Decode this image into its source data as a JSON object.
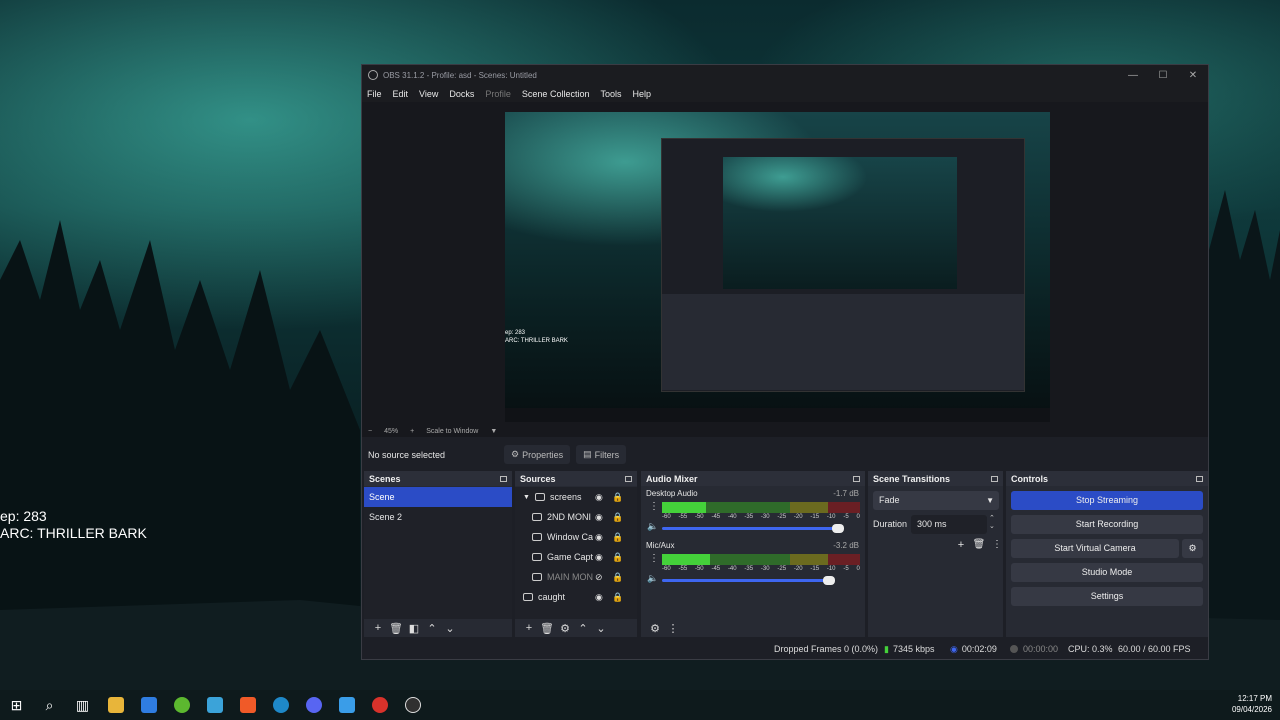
{
  "desktop": {
    "overlay_line1": "ep: 283",
    "overlay_line2": "ARC: THRILLER BARK"
  },
  "window": {
    "title": "OBS 31.1.2 - Profile: asd - Scenes: Untitled",
    "controls": [
      "—",
      "☐",
      "✕"
    ]
  },
  "menu": [
    "File",
    "Edit",
    "View",
    "Docks",
    "Profile",
    "Scene Collection",
    "Tools",
    "Help"
  ],
  "preview": {
    "zoom_minus": "−",
    "zoom_level": "45%",
    "zoom_plus": "+",
    "scale_mode": "Scale to Window",
    "overlay_line1": "ep: 283",
    "overlay_line2": "ARC: THRILLER BARK"
  },
  "properties_bar": {
    "no_source": "No source selected",
    "properties_label": "Properties",
    "filters_label": "Filters"
  },
  "scenes": {
    "title": "Scenes",
    "items": [
      {
        "label": "Scene",
        "selected": true
      },
      {
        "label": "Scene 2",
        "selected": false
      }
    ]
  },
  "sources": {
    "title": "Sources",
    "items": [
      {
        "label": "screens",
        "type": "group",
        "indent": 0
      },
      {
        "label": "2ND MONI",
        "type": "display",
        "indent": 1
      },
      {
        "label": "Window Ca",
        "type": "window",
        "indent": 1
      },
      {
        "label": "Game Capt",
        "type": "game",
        "indent": 1
      },
      {
        "label": "MAIN MON",
        "type": "display",
        "indent": 1,
        "hidden": true
      },
      {
        "label": "caught",
        "type": "image",
        "indent": 0
      }
    ]
  },
  "audio_mixer": {
    "title": "Audio Mixer",
    "channels": [
      {
        "name": "Desktop Audio",
        "db": "-1.7 dB",
        "level": 0.22,
        "volume": 0.98
      },
      {
        "name": "Mic/Aux",
        "db": "-3.2 dB",
        "level": 0.24,
        "volume": 0.93
      }
    ],
    "ticks": [
      "-60",
      "-55",
      "-50",
      "-45",
      "-40",
      "-35",
      "-30",
      "-25",
      "-20",
      "-15",
      "-10",
      "-5",
      "0"
    ]
  },
  "scene_transitions": {
    "title": "Scene Transitions",
    "transition": "Fade",
    "duration_label": "Duration",
    "duration_value": "300 ms"
  },
  "controls": {
    "title": "Controls",
    "stop_streaming": "Stop Streaming",
    "start_recording": "Start Recording",
    "start_virtual_camera": "Start Virtual Camera",
    "studio_mode": "Studio Mode",
    "settings": "Settings"
  },
  "status": {
    "dropped_frames": "Dropped Frames 0 (0.0%)",
    "bitrate": "7345 kbps",
    "stream_time": "00:02:09",
    "record_time": "00:00:00",
    "cpu": "CPU: 0.3%",
    "fps": "60.00 / 60.00 FPS"
  },
  "taskbar": {
    "time": "12:17 PM",
    "date": "09/04/2026"
  },
  "colors": {
    "accent": "#2b4cc6",
    "dock_bg": "#272a33",
    "window_bg": "#1d1f26"
  }
}
